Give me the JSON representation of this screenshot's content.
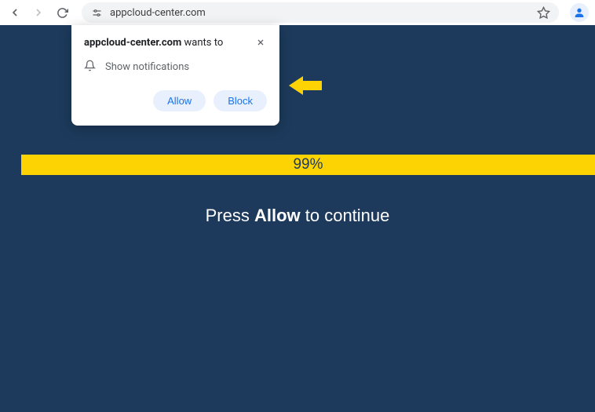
{
  "browser": {
    "url": "appcloud-center.com"
  },
  "popup": {
    "domain": "appcloud-center.com",
    "wants_to": " wants to",
    "permission": "Show notifications",
    "allow_label": "Allow",
    "block_label": "Block"
  },
  "page": {
    "progress": "99%",
    "instruction_prefix": "Press ",
    "instruction_bold": "Allow",
    "instruction_suffix": " to continue"
  },
  "colors": {
    "page_bg": "#1d3a5c",
    "accent_yellow": "#fed304",
    "chrome_blue": "#1a73e8"
  }
}
